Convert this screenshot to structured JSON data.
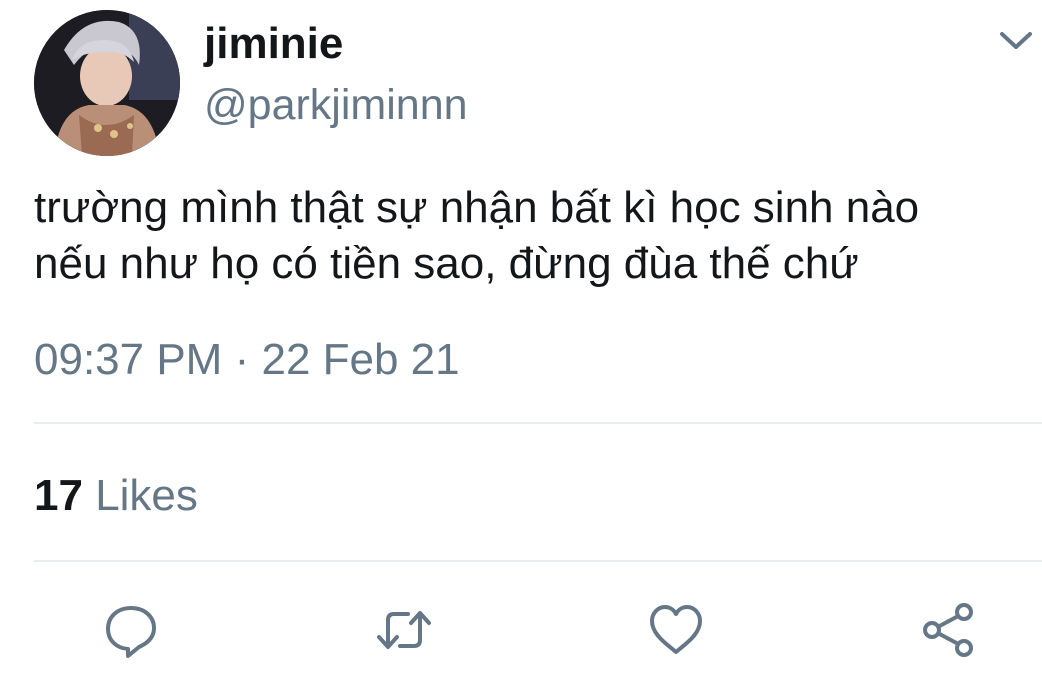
{
  "user": {
    "display_name": "jiminie",
    "handle": "@parkjiminnn"
  },
  "tweet": {
    "text_lines": [
      "trường mình thật sự nhận bất kì học sinh nào",
      "nếu như họ có tiền sao, đừng đùa thế chứ"
    ],
    "time": "09:37 PM",
    "separator": "·",
    "date": "22 Feb 21"
  },
  "stats": {
    "likes_count": "17",
    "likes_label": "Likes"
  },
  "icons": {
    "menu": "chevron-down-icon",
    "reply": "reply-icon",
    "retweet": "retweet-icon",
    "like": "heart-icon",
    "share": "share-icon"
  },
  "colors": {
    "primary_text": "#14171a",
    "secondary_text": "#657786",
    "divider": "#e6ecf0",
    "icon": "#657786"
  }
}
